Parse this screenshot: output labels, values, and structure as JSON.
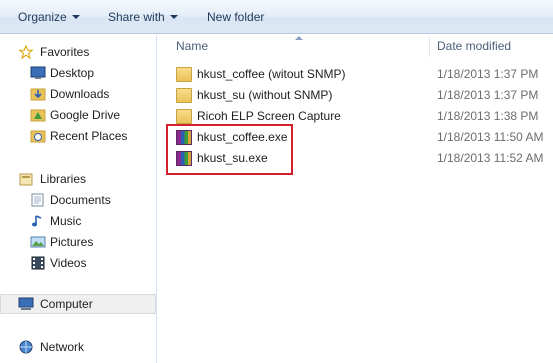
{
  "toolbar": {
    "organize": "Organize",
    "share_with": "Share with",
    "new_folder": "New folder"
  },
  "nav": {
    "favorites": "Favorites",
    "desktop": "Desktop",
    "downloads": "Downloads",
    "google_drive": "Google Drive",
    "recent_places": "Recent Places",
    "libraries": "Libraries",
    "documents": "Documents",
    "music": "Music",
    "pictures": "Pictures",
    "videos": "Videos",
    "computer": "Computer",
    "network": "Network"
  },
  "columns": {
    "name": "Name",
    "date_modified": "Date modified"
  },
  "files": [
    {
      "name": "hkust_coffee (witout SNMP)",
      "date": "1/18/2013 1:37 PM",
      "type": "folder"
    },
    {
      "name": "hkust_su (without SNMP)",
      "date": "1/18/2013 1:37 PM",
      "type": "folder"
    },
    {
      "name": "Ricoh ELP Screen Capture",
      "date": "1/18/2013 1:38 PM",
      "type": "folder"
    },
    {
      "name": "hkust_coffee.exe",
      "date": "1/18/2013 11:50 AM",
      "type": "rar-exe"
    },
    {
      "name": "hkust_su.exe",
      "date": "1/18/2013 11:52 AM",
      "type": "rar-exe"
    }
  ],
  "colors": {
    "highlight_box": "#d0202b",
    "toolbar_text": "#1e395b"
  }
}
